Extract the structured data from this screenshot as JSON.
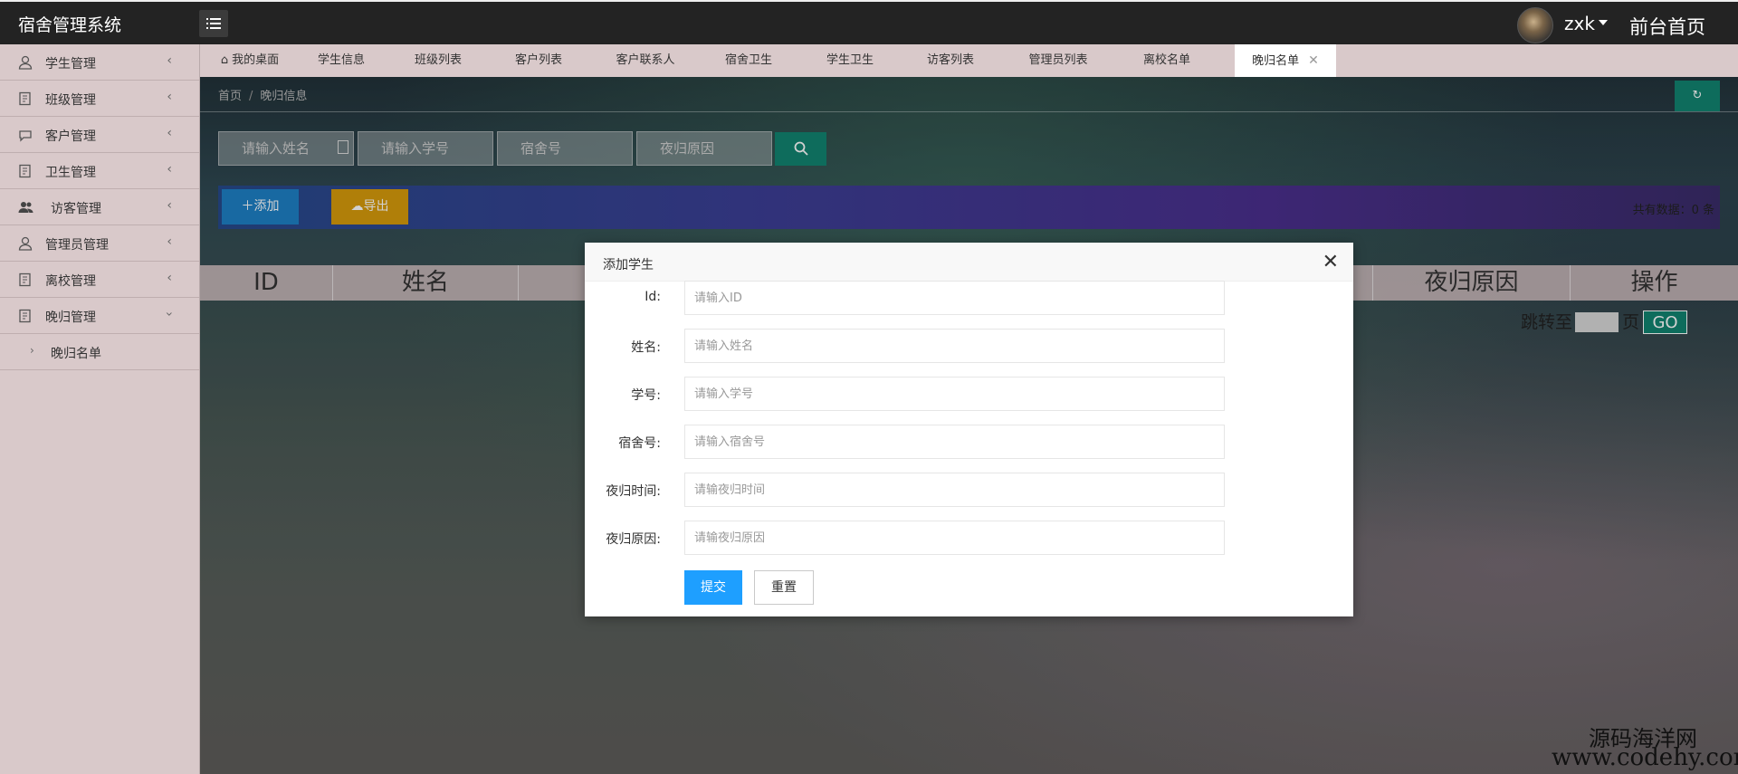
{
  "app": {
    "title": "宿舍管理系统"
  },
  "header": {
    "username": "zxk",
    "front_link": "前台首页"
  },
  "sidebar": {
    "items": [
      {
        "label": "学生管理",
        "icon": "user-icon"
      },
      {
        "label": "班级管理",
        "icon": "document-icon"
      },
      {
        "label": "客户管理",
        "icon": "chat-icon"
      },
      {
        "label": "卫生管理",
        "icon": "document-icon"
      },
      {
        "label": "访客管理",
        "icon": "group-icon"
      },
      {
        "label": "管理员管理",
        "icon": "user-icon"
      },
      {
        "label": "离校管理",
        "icon": "document-icon"
      },
      {
        "label": "晚归管理",
        "icon": "document-icon"
      }
    ],
    "sub_item": "晚归名单"
  },
  "tabs": [
    "我的桌面",
    "学生信息",
    "班级列表",
    "客户列表",
    "客户联系人",
    "宿舍卫生",
    "学生卫生",
    "访客列表",
    "管理员列表",
    "离校名单",
    "晚归名单"
  ],
  "breadcrumb": {
    "home": "首页",
    "separator": "/",
    "current": "晚归信息"
  },
  "search": {
    "name_placeholder": "请输入姓名",
    "student_no_placeholder": "请输入学号",
    "dorm_placeholder": "宿舍号",
    "reason_placeholder": "夜归原因"
  },
  "actions": {
    "add_label": "添加",
    "export_label": "导出",
    "total": "共有数据：0 条"
  },
  "table": {
    "headers": [
      "ID",
      "姓名",
      "",
      "夜归原因",
      "操作"
    ]
  },
  "pager": {
    "prefix": "跳转至",
    "suffix": "页",
    "go": "GO"
  },
  "modal": {
    "title": "添加学生",
    "fields": [
      {
        "label": "Id:",
        "placeholder": "请输入ID"
      },
      {
        "label": "姓名:",
        "placeholder": "请输入姓名"
      },
      {
        "label": "学号:",
        "placeholder": "请输入学号"
      },
      {
        "label": "宿舍号:",
        "placeholder": "请输入宿舍号"
      },
      {
        "label": "夜归时间:",
        "placeholder": "请输夜归时间"
      },
      {
        "label": "夜归原因:",
        "placeholder": "请输夜归原因"
      }
    ],
    "submit_label": "提交",
    "reset_label": "重置"
  },
  "watermark": {
    "cn": "源码海洋网",
    "url": "www.codehy.com"
  },
  "colors": {
    "topbar": "#232323",
    "sidebar": "#d9c9ca",
    "primary_green": "#128471",
    "add_blue": "#1e80c6",
    "export_orange": "#d79b0b",
    "submit_blue": "#1e9fff"
  }
}
